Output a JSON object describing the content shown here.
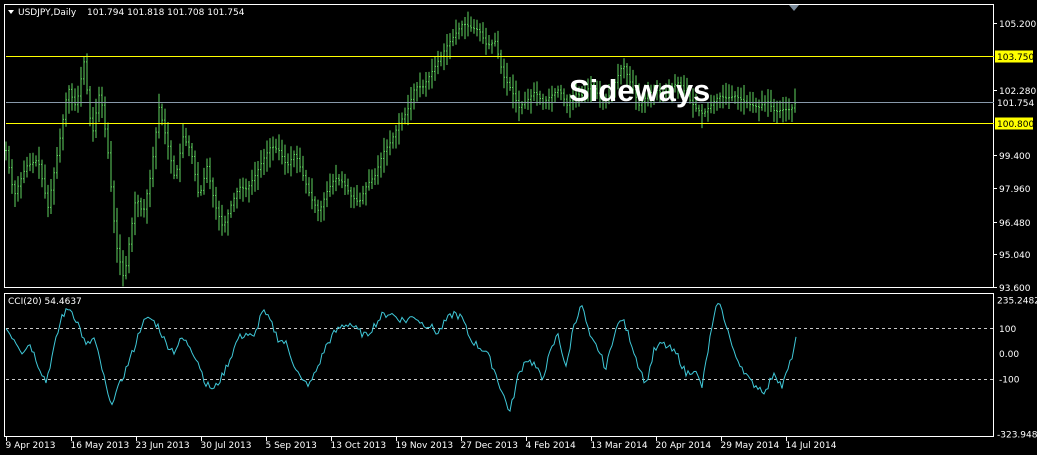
{
  "header": {
    "symbol_label": "USDJPY,Daily",
    "ohlc_label": "101.794 101.818 101.708 101.754"
  },
  "cci_header": {
    "label": "CCI(20) 54.4637"
  },
  "annotation": {
    "text": "Sideways"
  },
  "colors": {
    "background": "#000000",
    "bars": "#5fd35f",
    "cci_line": "#3fc8d8",
    "support_resistance": "#ffff00",
    "current_price_line": "#8899aa",
    "axis": "#ffffff",
    "cci_level_lines": "#c8c8c8"
  },
  "chart_data": [
    {
      "type": "line",
      "title": "USDJPY,Daily",
      "ylim": [
        93.6,
        106.0
      ],
      "y_tick_labels": [
        "105.200",
        "102.280",
        "99.400",
        "97.960",
        "96.480",
        "95.040",
        "93.600"
      ],
      "x_tick_labels": [
        "9 Apr 2013",
        "16 May 2013",
        "23 Jun 2013",
        "30 Jul 2013",
        "5 Sep 2013",
        "13 Oct 2013",
        "19 Nov 2013",
        "27 Dec 2013",
        "4 Feb 2014",
        "13 Mar 2014",
        "20 Apr 2014",
        "29 May 2014",
        "14 Jul 2014"
      ],
      "horizontal_lines": [
        {
          "value": 103.75,
          "label": "103.750",
          "style": "support_resistance"
        },
        {
          "value": 100.8,
          "label": "100.800",
          "style": "support_resistance"
        },
        {
          "value": 101.754,
          "label": "101.754",
          "style": "current_price"
        }
      ],
      "price_path": [
        [
          0,
          99.6
        ],
        [
          8,
          97.6
        ],
        [
          20,
          98.9
        ],
        [
          32,
          99.2
        ],
        [
          42,
          97.1
        ],
        [
          55,
          100.4
        ],
        [
          62,
          102.4
        ],
        [
          70,
          101.5
        ],
        [
          78,
          103.5
        ],
        [
          86,
          100.2
        ],
        [
          94,
          102.3
        ],
        [
          102,
          99.5
        ],
        [
          110,
          95.5
        ],
        [
          118,
          93.9
        ],
        [
          124,
          95.8
        ],
        [
          130,
          97.6
        ],
        [
          137,
          96.8
        ],
        [
          145,
          98.6
        ],
        [
          153,
          101.5
        ],
        [
          161,
          100.0
        ],
        [
          169,
          98.3
        ],
        [
          177,
          100.2
        ],
        [
          185,
          99.6
        ],
        [
          193,
          97.5
        ],
        [
          201,
          98.9
        ],
        [
          209,
          97.2
        ],
        [
          217,
          96.2
        ],
        [
          225,
          97.2
        ],
        [
          233,
          98.0
        ],
        [
          241,
          97.9
        ],
        [
          249,
          98.5
        ],
        [
          257,
          99.2
        ],
        [
          265,
          99.8
        ],
        [
          273,
          99.6
        ],
        [
          281,
          98.9
        ],
        [
          289,
          99.5
        ],
        [
          297,
          98.5
        ],
        [
          305,
          97.5
        ],
        [
          313,
          96.9
        ],
        [
          321,
          97.8
        ],
        [
          329,
          98.4
        ],
        [
          337,
          98.2
        ],
        [
          345,
          97.6
        ],
        [
          353,
          97.3
        ],
        [
          361,
          98.1
        ],
        [
          369,
          98.5
        ],
        [
          377,
          99.5
        ],
        [
          385,
          100.0
        ],
        [
          393,
          100.8
        ],
        [
          401,
          101.3
        ],
        [
          409,
          102.4
        ],
        [
          417,
          102.4
        ],
        [
          425,
          103.0
        ],
        [
          433,
          103.6
        ],
        [
          441,
          104.2
        ],
        [
          449,
          104.7
        ],
        [
          457,
          105.2
        ],
        [
          465,
          105.0
        ],
        [
          473,
          104.9
        ],
        [
          481,
          104.2
        ],
        [
          489,
          104.4
        ],
        [
          497,
          102.9
        ],
        [
          505,
          102.3
        ],
        [
          513,
          101.5
        ],
        [
          521,
          101.8
        ],
        [
          529,
          102.2
        ],
        [
          537,
          101.7
        ],
        [
          545,
          102.0
        ],
        [
          553,
          102.3
        ],
        [
          561,
          101.6
        ],
        [
          569,
          102.1
        ],
        [
          577,
          102.0
        ],
        [
          585,
          102.5
        ],
        [
          593,
          102.0
        ],
        [
          601,
          101.8
        ],
        [
          609,
          102.6
        ],
        [
          617,
          103.4
        ],
        [
          625,
          102.5
        ],
        [
          633,
          101.6
        ],
        [
          641,
          102.0
        ],
        [
          649,
          102.3
        ],
        [
          657,
          102.1
        ],
        [
          665,
          102.4
        ],
        [
          673,
          102.6
        ],
        [
          681,
          102.0
        ],
        [
          689,
          101.5
        ],
        [
          697,
          101.2
        ],
        [
          705,
          101.6
        ],
        [
          713,
          102.0
        ],
        [
          721,
          101.9
        ],
        [
          729,
          102.0
        ],
        [
          737,
          101.8
        ],
        [
          745,
          101.6
        ],
        [
          753,
          101.5
        ],
        [
          761,
          101.8
        ],
        [
          769,
          101.3
        ],
        [
          777,
          101.4
        ],
        [
          785,
          101.4
        ],
        [
          790,
          101.754
        ]
      ]
    },
    {
      "type": "line",
      "title": "CCI(20) 54.4637",
      "ylim": [
        -323.9487,
        235.2482
      ],
      "y_tick_labels": [
        "235.2482",
        "100",
        "0.00",
        "-100",
        "-323.9487"
      ],
      "level_lines": [
        100,
        -100
      ],
      "cci_path": [
        [
          0,
          100
        ],
        [
          8,
          60
        ],
        [
          16,
          10
        ],
        [
          24,
          40
        ],
        [
          32,
          -40
        ],
        [
          40,
          -110
        ],
        [
          48,
          20
        ],
        [
          56,
          150
        ],
        [
          64,
          180
        ],
        [
          72,
          120
        ],
        [
          80,
          30
        ],
        [
          88,
          60
        ],
        [
          96,
          -60
        ],
        [
          104,
          -200
        ],
        [
          112,
          -140
        ],
        [
          120,
          -60
        ],
        [
          128,
          20
        ],
        [
          136,
          120
        ],
        [
          144,
          140
        ],
        [
          152,
          110
        ],
        [
          160,
          40
        ],
        [
          168,
          10
        ],
        [
          176,
          60
        ],
        [
          184,
          30
        ],
        [
          192,
          -30
        ],
        [
          200,
          -120
        ],
        [
          208,
          -140
        ],
        [
          216,
          -90
        ],
        [
          224,
          -20
        ],
        [
          232,
          60
        ],
        [
          240,
          80
        ],
        [
          248,
          60
        ],
        [
          256,
          170
        ],
        [
          264,
          130
        ],
        [
          272,
          60
        ],
        [
          280,
          40
        ],
        [
          288,
          -40
        ],
        [
          296,
          -110
        ],
        [
          304,
          -120
        ],
        [
          312,
          -50
        ],
        [
          320,
          30
        ],
        [
          328,
          80
        ],
        [
          336,
          110
        ],
        [
          344,
          120
        ],
        [
          352,
          90
        ],
        [
          360,
          70
        ],
        [
          368,
          110
        ],
        [
          376,
          150
        ],
        [
          384,
          160
        ],
        [
          392,
          140
        ],
        [
          400,
          130
        ],
        [
          408,
          150
        ],
        [
          416,
          120
        ],
        [
          424,
          110
        ],
        [
          432,
          80
        ],
        [
          440,
          130
        ],
        [
          448,
          160
        ],
        [
          456,
          140
        ],
        [
          464,
          60
        ],
        [
          472,
          30
        ],
        [
          480,
          10
        ],
        [
          488,
          -60
        ],
        [
          496,
          -150
        ],
        [
          504,
          -230
        ],
        [
          512,
          -90
        ],
        [
          520,
          -20
        ],
        [
          528,
          -40
        ],
        [
          536,
          -100
        ],
        [
          544,
          0
        ],
        [
          552,
          80
        ],
        [
          560,
          -60
        ],
        [
          568,
          120
        ],
        [
          576,
          190
        ],
        [
          584,
          60
        ],
        [
          592,
          20
        ],
        [
          600,
          -60
        ],
        [
          608,
          80
        ],
        [
          616,
          140
        ],
        [
          624,
          60
        ],
        [
          632,
          -40
        ],
        [
          640,
          -120
        ],
        [
          648,
          10
        ],
        [
          656,
          40
        ],
        [
          664,
          20
        ],
        [
          672,
          -10
        ],
        [
          680,
          -80
        ],
        [
          688,
          -60
        ],
        [
          696,
          -130
        ],
        [
          704,
          60
        ],
        [
          712,
          210
        ],
        [
          720,
          120
        ],
        [
          728,
          0
        ],
        [
          736,
          -50
        ],
        [
          744,
          -110
        ],
        [
          752,
          -130
        ],
        [
          760,
          -150
        ],
        [
          768,
          -70
        ],
        [
          776,
          -130
        ],
        [
          784,
          -40
        ],
        [
          790,
          54.4637
        ]
      ]
    }
  ]
}
